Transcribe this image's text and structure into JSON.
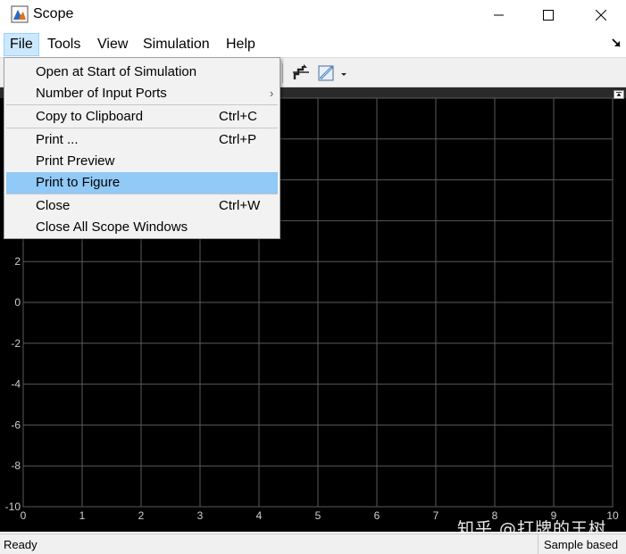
{
  "window": {
    "title": "Scope",
    "controls": {
      "minimize": "minimize",
      "maximize": "maximize",
      "close": "close"
    }
  },
  "menubar": {
    "items": [
      {
        "label": "File",
        "active": true
      },
      {
        "label": "Tools"
      },
      {
        "label": "View"
      },
      {
        "label": "Simulation"
      },
      {
        "label": "Help"
      }
    ]
  },
  "file_menu": {
    "items": [
      {
        "label": "Open at Start of Simulation",
        "shortcut": ""
      },
      {
        "label": "Number of Input Ports",
        "shortcut": "",
        "submenu_arrow": "›"
      },
      {
        "label": "Copy to Clipboard",
        "shortcut": "Ctrl+C"
      },
      {
        "label": "Print ...",
        "shortcut": "Ctrl+P"
      },
      {
        "label": "Print Preview",
        "shortcut": ""
      },
      {
        "label": "Print to Figure",
        "shortcut": "",
        "highlighted": true
      },
      {
        "label": "Close",
        "shortcut": "Ctrl+W"
      },
      {
        "label": "Close All Scope Windows",
        "shortcut": ""
      }
    ]
  },
  "toolbar": {
    "icons": [
      "scale-axes-icon",
      "style-edit-icon",
      "dropdown-arrow-icon"
    ]
  },
  "plot": {
    "background": "#000000",
    "grid_color": "#5a5a5a",
    "tick_color": "#cfcfcf",
    "x_ticks": [
      "0",
      "1",
      "2",
      "3",
      "4",
      "5",
      "6",
      "7",
      "8",
      "9",
      "10"
    ],
    "y_ticks": [
      "-10",
      "-8",
      "-6",
      "-4",
      "-2",
      "0",
      "2"
    ],
    "xlim": [
      0,
      10
    ],
    "ylim": [
      -10,
      10
    ]
  },
  "status": {
    "left": "Ready",
    "right": "Sample based"
  },
  "watermark": "知乎 @打牌的王树"
}
